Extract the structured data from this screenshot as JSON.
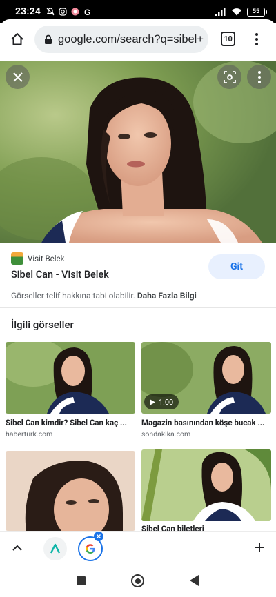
{
  "status_bar": {
    "time": "23:24",
    "battery": "55"
  },
  "browser": {
    "url": "google.com/search?q=sibel+",
    "tab_count": "10"
  },
  "viewer": {
    "source_name": "Visit Belek",
    "title": "Sibel Can - Visit Belek",
    "visit_button": "Git",
    "copyright_notice": "Görseller telif hakkına tabi olabilir.",
    "learn_more": "Daha Fazla Bilgi"
  },
  "related": {
    "heading": "İlgili görseller",
    "items": [
      {
        "title": "Sibel Can kimdir? Sibel Can kaç ...",
        "source": "haberturk.com"
      },
      {
        "title": "Magazin basınından köşe bucak ...",
        "source": "sondakika.com",
        "video_duration": "1:00"
      },
      {
        "title": "",
        "source": ""
      },
      {
        "title": "Sibel Can biletleri",
        "source": ""
      }
    ]
  },
  "colors": {
    "accent": "#1a73e8",
    "git_bg": "#e8f0fe",
    "url_bar_bg": "#eceff1"
  }
}
